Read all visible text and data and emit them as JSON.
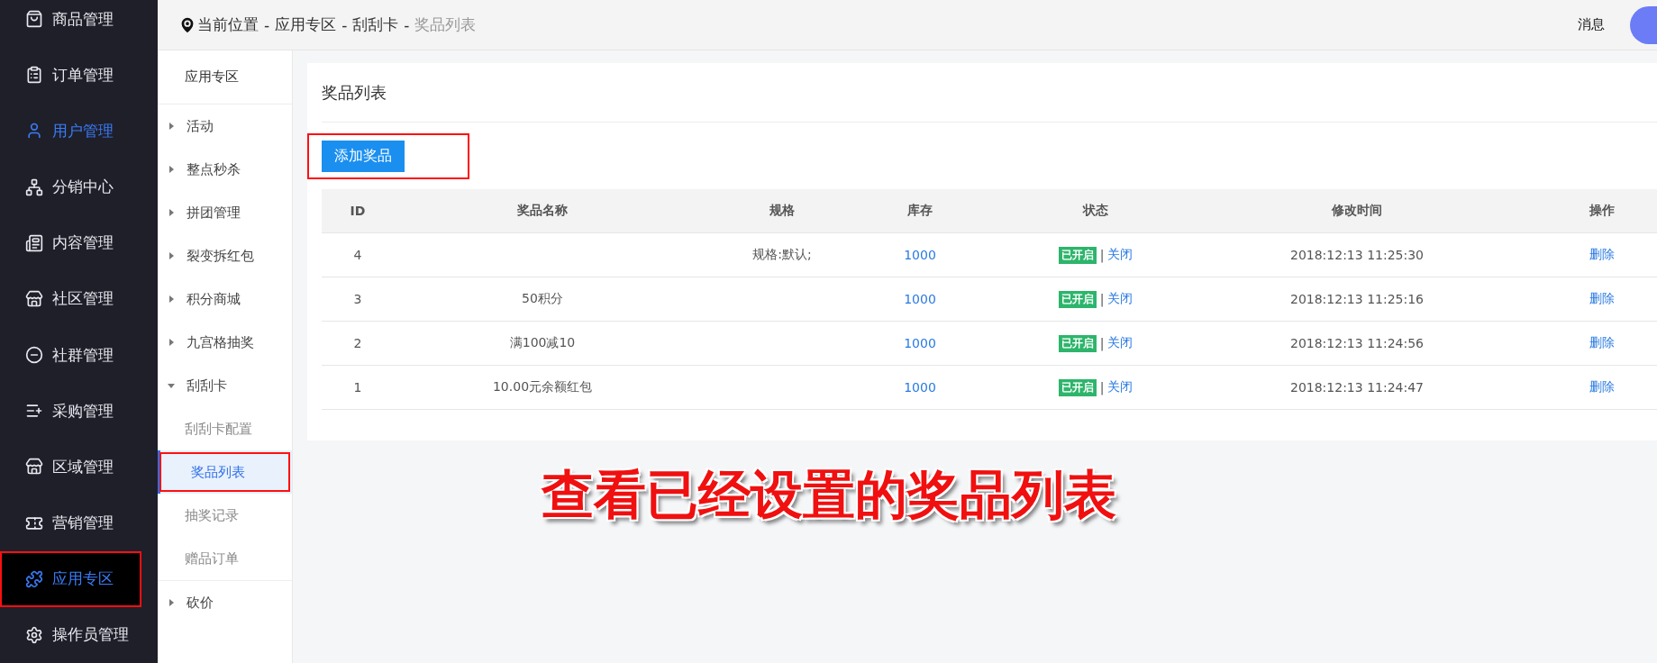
{
  "sidebar": {
    "items": [
      {
        "label": "商品管理",
        "selected": false,
        "hovered": false,
        "annotated": false
      },
      {
        "label": "订单管理",
        "selected": false,
        "hovered": false,
        "annotated": false
      },
      {
        "label": "用户管理",
        "selected": false,
        "hovered": true,
        "annotated": false
      },
      {
        "label": "分销中心",
        "selected": false,
        "hovered": false,
        "annotated": false
      },
      {
        "label": "内容管理",
        "selected": false,
        "hovered": false,
        "annotated": false
      },
      {
        "label": "社区管理",
        "selected": false,
        "hovered": false,
        "annotated": false
      },
      {
        "label": "社群管理",
        "selected": false,
        "hovered": false,
        "annotated": false
      },
      {
        "label": "采购管理",
        "selected": false,
        "hovered": false,
        "annotated": false
      },
      {
        "label": "区域管理",
        "selected": false,
        "hovered": false,
        "annotated": false
      },
      {
        "label": "营销管理",
        "selected": false,
        "hovered": false,
        "annotated": false
      },
      {
        "label": "应用专区",
        "selected": true,
        "hovered": false,
        "annotated": true
      },
      {
        "label": "操作员管理",
        "selected": false,
        "hovered": false,
        "annotated": false
      }
    ]
  },
  "breadcrumb": {
    "separator": "-",
    "items": [
      "当前位置",
      "应用专区",
      "刮刮卡",
      "奖品列表"
    ]
  },
  "header": {
    "messages": "消息"
  },
  "submenu": {
    "title": "应用专区",
    "groups": [
      {
        "label": "活动",
        "expanded": false
      },
      {
        "label": "整点秒杀",
        "expanded": false
      },
      {
        "label": "拼团管理",
        "expanded": false
      },
      {
        "label": "裂变拆红包",
        "expanded": false
      },
      {
        "label": "积分商城",
        "expanded": false
      },
      {
        "label": "九宫格抽奖",
        "expanded": false
      },
      {
        "label": "刮刮卡",
        "expanded": true,
        "children": [
          {
            "label": "刮刮卡配置",
            "selected": false,
            "annotated": false
          },
          {
            "label": "奖品列表",
            "selected": true,
            "annotated": true
          },
          {
            "label": "抽奖记录",
            "selected": false,
            "annotated": false
          },
          {
            "label": "赠品订单",
            "selected": false,
            "annotated": false
          }
        ]
      },
      {
        "label": "砍价",
        "expanded": false
      }
    ]
  },
  "panel": {
    "title": "奖品列表",
    "add_button": "添加奖品",
    "add_button_annotated": true
  },
  "table": {
    "status_separator": "|",
    "columns": [
      "ID",
      "奖品名称",
      "规格",
      "库存",
      "状态",
      "修改时间",
      "操作"
    ],
    "rows": [
      {
        "id": "4",
        "name": "",
        "spec": "规格:默认;",
        "stock": "1000",
        "status": {
          "badge": "已开启",
          "toggle": "关闭",
          "on": true
        },
        "time": "2018:12:13 11:25:30",
        "action": "删除"
      },
      {
        "id": "3",
        "name": "50积分",
        "spec": "",
        "stock": "1000",
        "status": {
          "badge": "已开启",
          "toggle": "关闭",
          "on": true
        },
        "time": "2018:12:13 11:25:16",
        "action": "删除"
      },
      {
        "id": "2",
        "name": "满100减10",
        "spec": "",
        "stock": "1000",
        "status": {
          "badge": "已开启",
          "toggle": "关闭",
          "on": true
        },
        "time": "2018:12:13 11:24:56",
        "action": "删除"
      },
      {
        "id": "1",
        "name": "10.00元余额红包",
        "spec": "",
        "stock": "1000",
        "status": {
          "badge": "已开启",
          "toggle": "关闭",
          "on": true
        },
        "time": "2018:12:13 11:24:47",
        "action": "删除"
      }
    ]
  },
  "caption": "查看已经设置的奖品列表"
}
